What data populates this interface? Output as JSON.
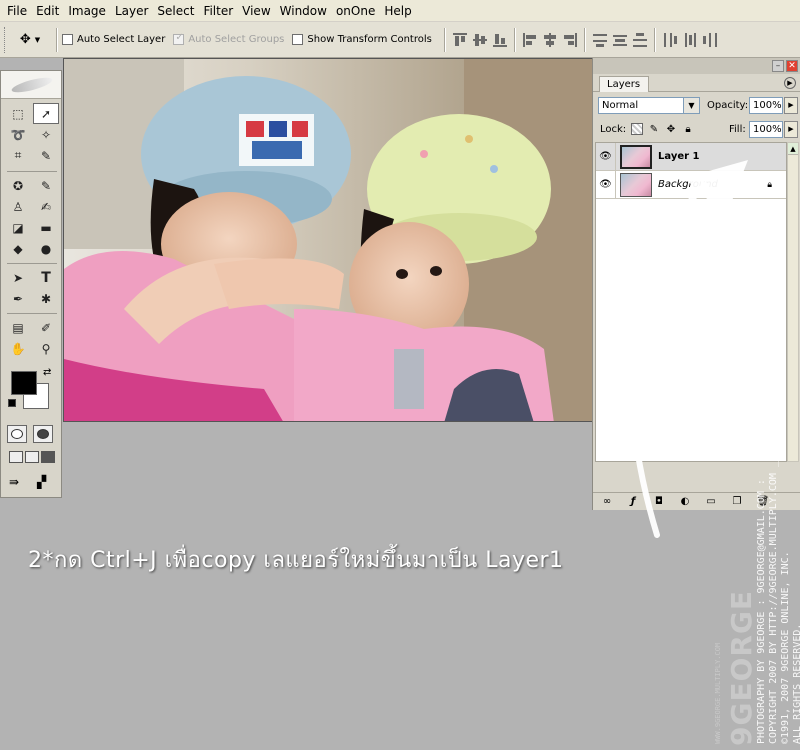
{
  "menu": [
    "File",
    "Edit",
    "Image",
    "Layer",
    "Select",
    "Filter",
    "View",
    "Window",
    "onOne",
    "Help"
  ],
  "options_bar": {
    "auto_select_layer": "Auto Select Layer",
    "auto_select_groups": "Auto Select Groups",
    "show_transform_controls": "Show Transform Controls"
  },
  "layers_panel": {
    "tab": "Layers",
    "blend_mode": "Normal",
    "opacity_label": "Opacity:",
    "opacity": "100%",
    "lock_label": "Lock:",
    "fill_label": "Fill:",
    "fill": "100%",
    "layers": [
      {
        "name": "Layer 1",
        "active": true
      },
      {
        "name": "Background",
        "active": false
      }
    ]
  },
  "caption": "2*กด Ctrl+J เพื่อcopy เลแยอร์ใหม่ขึ้นมาเป็น Layer1",
  "watermark": {
    "line1": "PHOTOGRAPHY BY 9GEORGE : 9GEORGE@GMAIL.COM :",
    "line2": "COPYRIGHT 2007 BY HTTP://9GEORGE.MULTIPLY.COM _PAKPONG PONGATICHAT",
    "line3": "©1991, 2007 9GEORGE ONLINE, INC.",
    "line4": "ALL RIGHTS RESERVED.",
    "brand": "9GEORGE",
    "brand_url": "WWW.9GEORGE.MULTIPLY.COM"
  }
}
